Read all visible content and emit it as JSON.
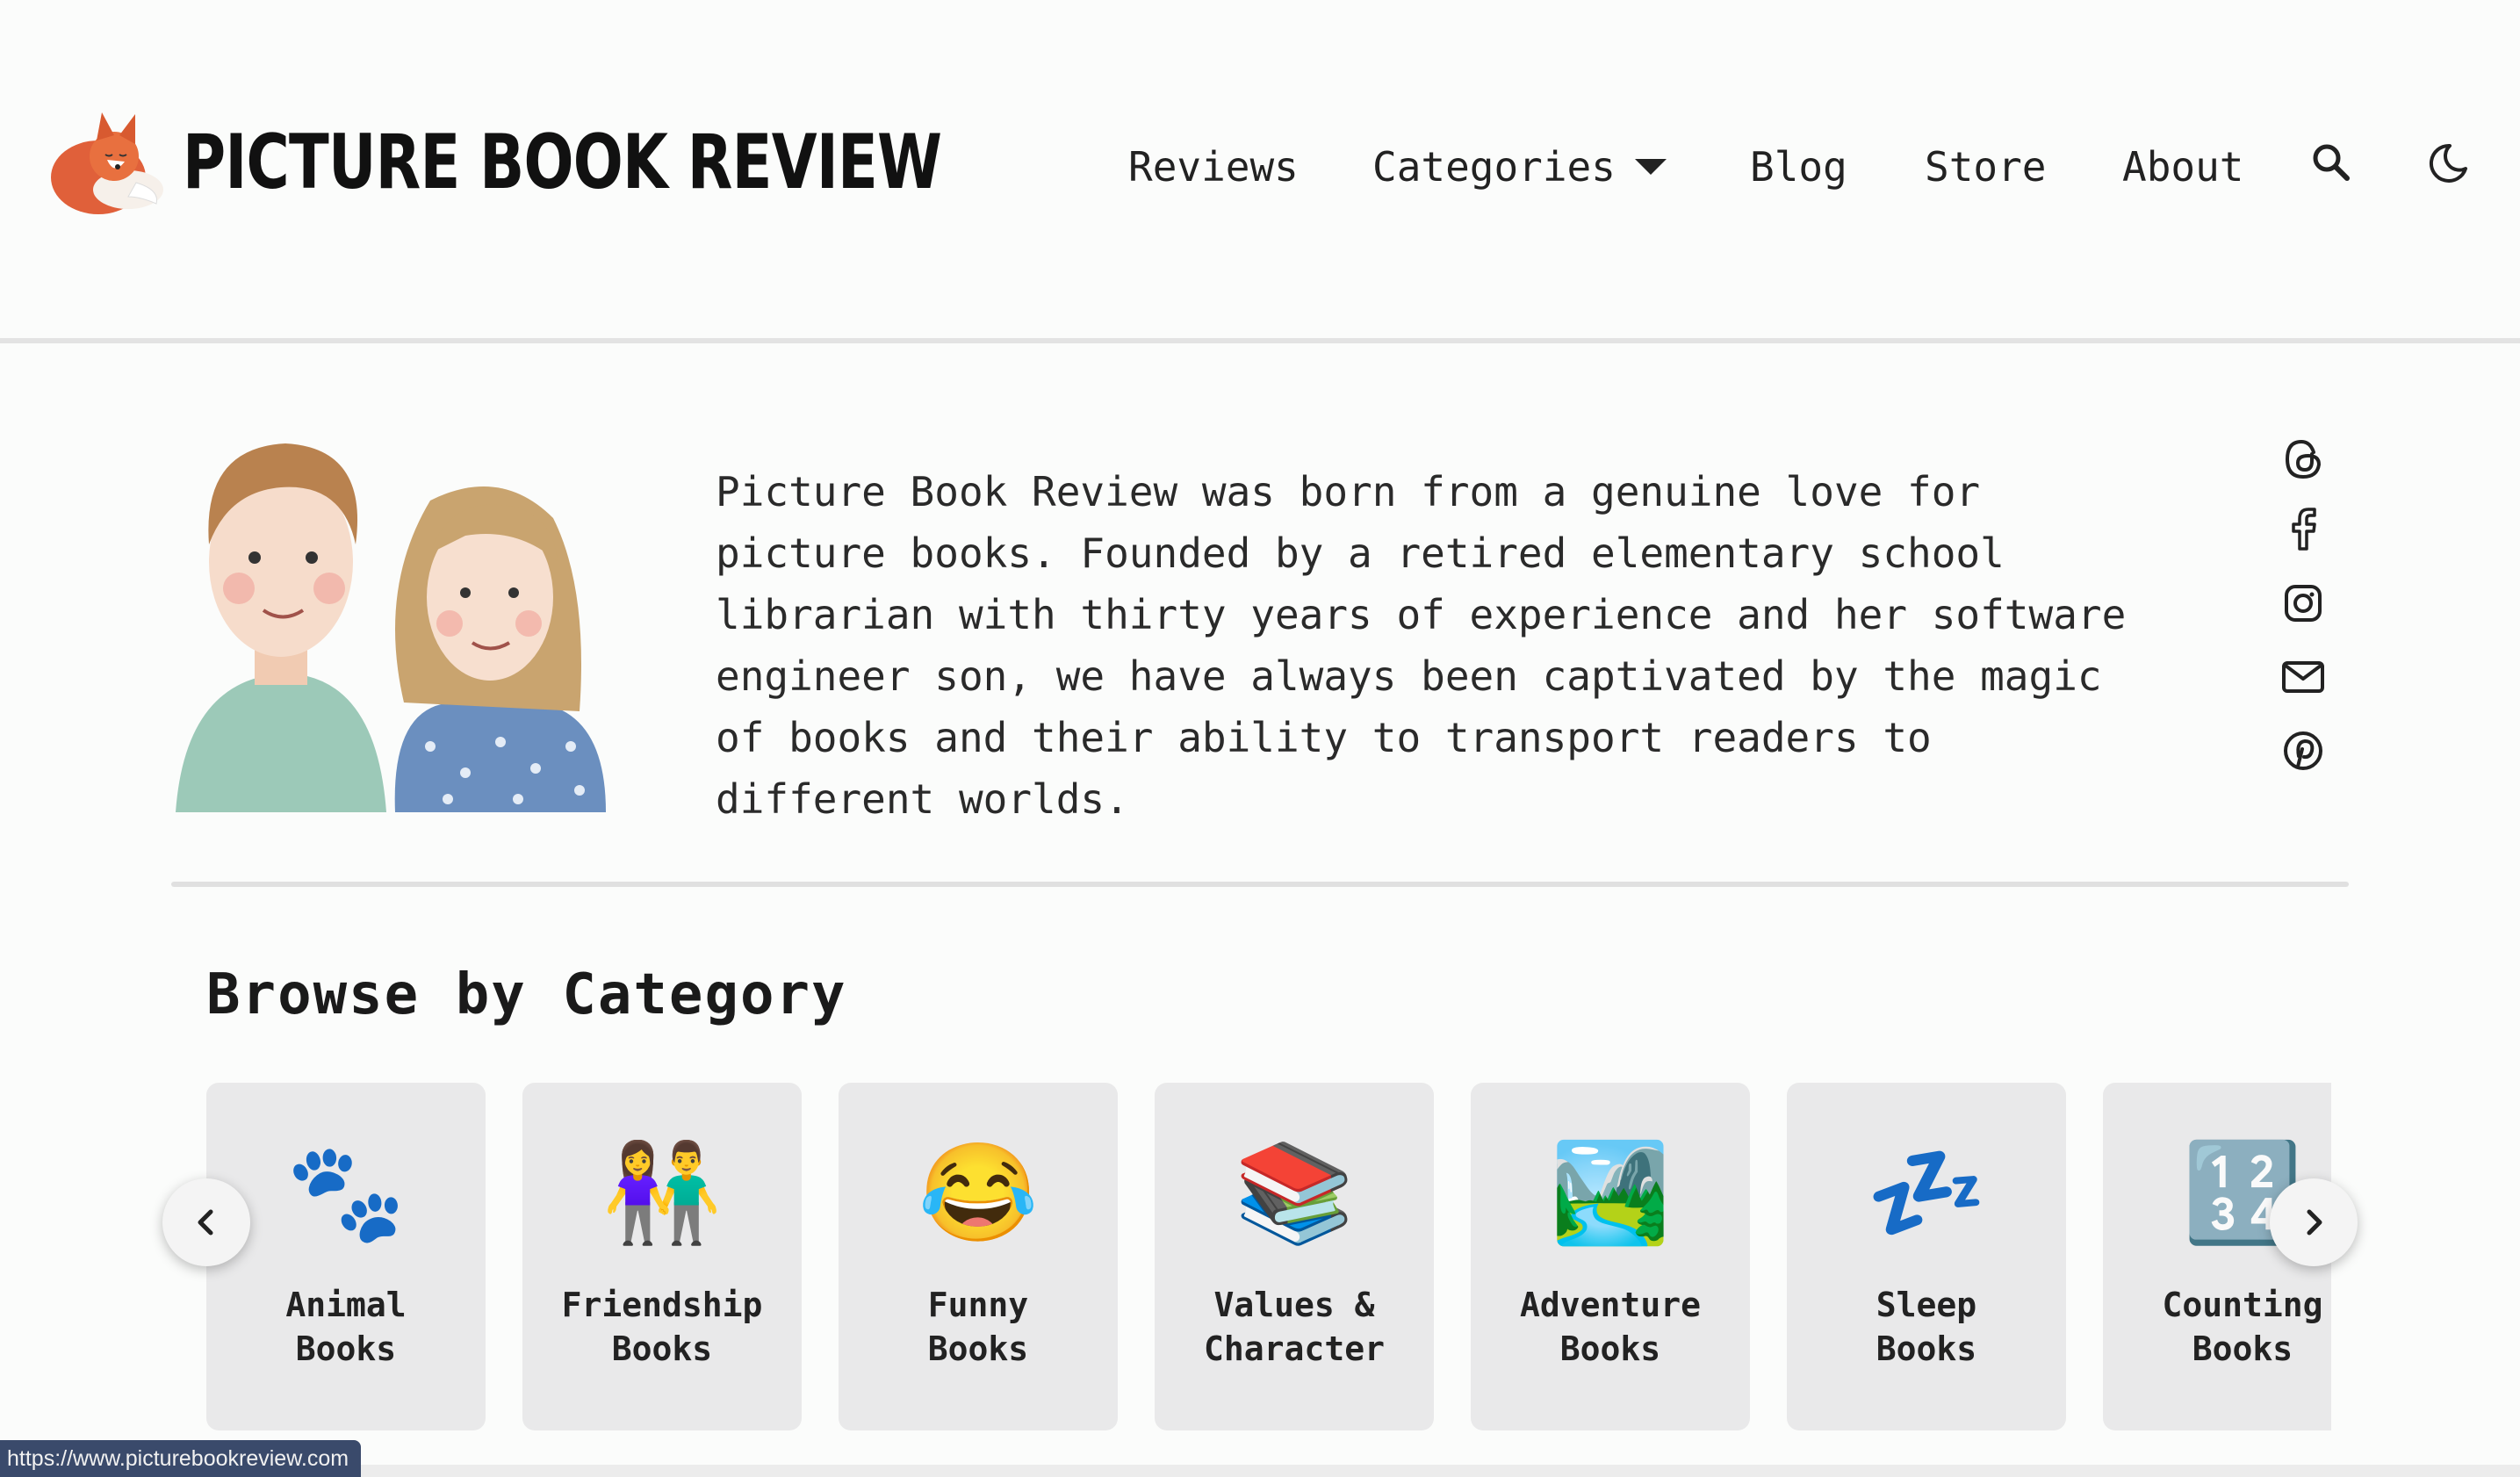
{
  "header": {
    "logo_text": "PICTURE BOOK REVIEW",
    "nav": {
      "reviews": "Reviews",
      "categories": "Categories",
      "blog": "Blog",
      "store": "Store",
      "about": "About"
    }
  },
  "intro": {
    "text": "Picture Book Review was born from a genuine love for picture books. Founded by a retired elementary school librarian with thirty years of experience and her software engineer son, we have always been captivated by the magic of books and their ability to transport readers to different worlds."
  },
  "social": [
    "threads-icon",
    "facebook-icon",
    "instagram-icon",
    "email-icon",
    "pinterest-icon"
  ],
  "browse": {
    "title": "Browse by Category",
    "categories": [
      {
        "emoji": "🐾",
        "line1": "Animal",
        "line2": "Books"
      },
      {
        "emoji": "👫",
        "line1": "Friendship",
        "line2": "Books"
      },
      {
        "emoji": "😂",
        "line1": "Funny",
        "line2": "Books"
      },
      {
        "emoji": "📚",
        "line1": "Values &",
        "line2": "Character"
      },
      {
        "emoji": "🏞️",
        "line1": "Adventure",
        "line2": "Books"
      },
      {
        "emoji": "💤",
        "line1": "Sleep",
        "line2": "Books"
      },
      {
        "emoji": "🔢",
        "line1": "Counting",
        "line2": "Books"
      }
    ]
  },
  "status_bar": {
    "url": "https://www.picturebookreview.com"
  },
  "colors": {
    "background": "#fbfcfb",
    "card": "#e9e9ea",
    "text": "#1d1d1d",
    "status_bar": "#3a4a6b"
  }
}
